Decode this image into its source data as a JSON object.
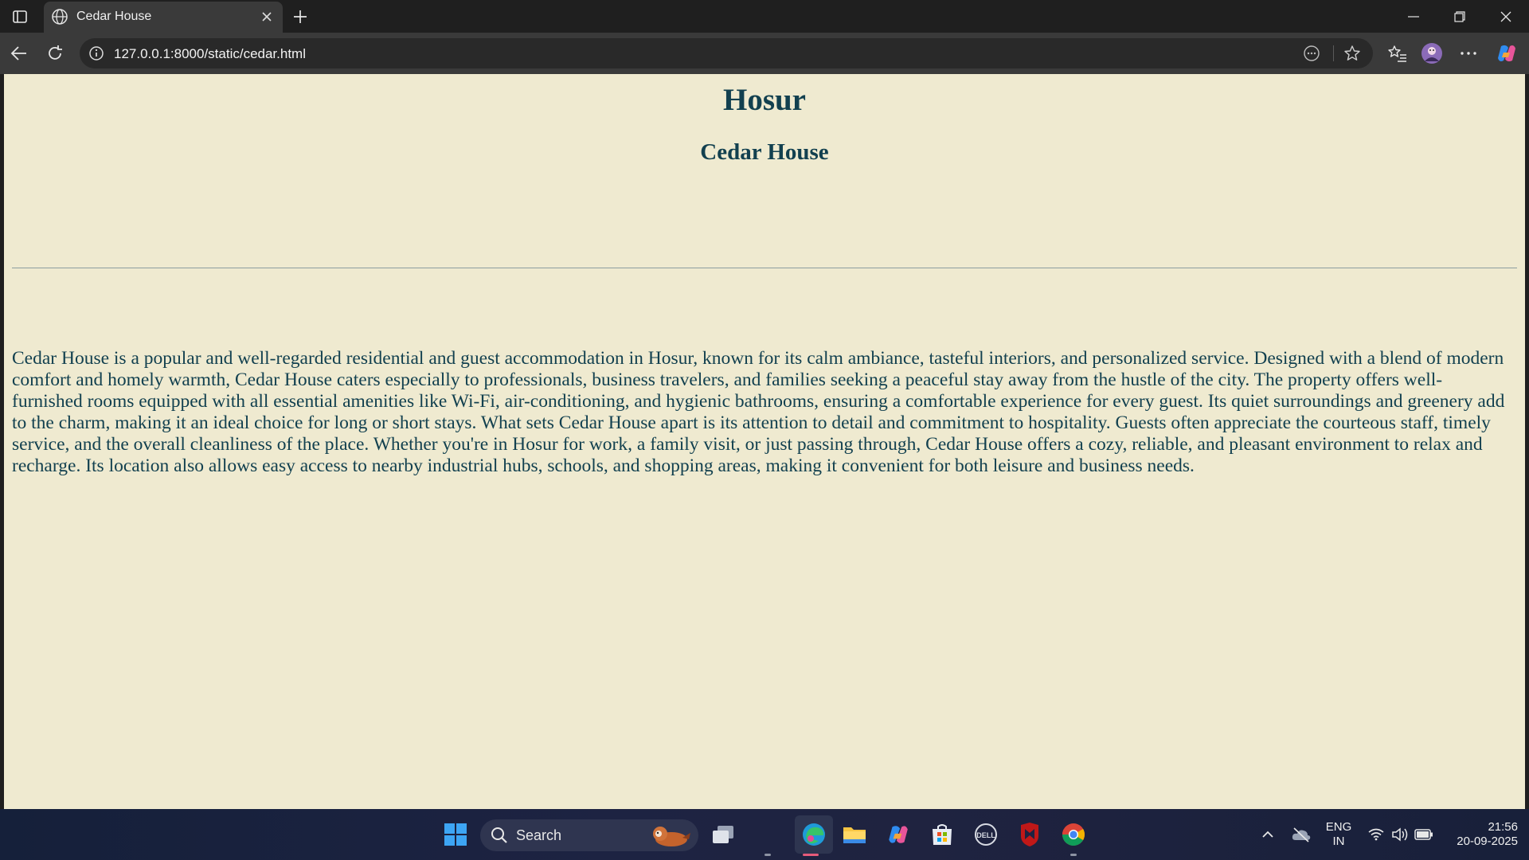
{
  "browser": {
    "tab": {
      "title": "Cedar House",
      "icon": "globe-icon"
    },
    "address_bar": {
      "url": "127.0.0.1:8000/static/cedar.html",
      "info_icon": "info-icon"
    },
    "toolbar_icons": [
      "reading-mode-icon",
      "favorite-star-icon",
      "favorites-list-icon",
      "profile-avatar",
      "more-menu-icon",
      "copilot-icon"
    ],
    "window_controls": [
      "minimize-icon",
      "restore-icon",
      "close-icon"
    ]
  },
  "page": {
    "heading": "Hosur",
    "subheading": "Cedar House",
    "description": "Cedar House is a popular and well-regarded residential and guest accommodation in Hosur, known for its calm ambiance, tasteful interiors, and personalized service. Designed with a blend of modern comfort and homely warmth, Cedar House caters especially to professionals, business travelers, and families seeking a peaceful stay away from the hustle of the city. The property offers well-furnished rooms equipped with all essential amenities like Wi-Fi, air-conditioning, and hygienic bathrooms, ensuring a comfortable experience for every guest. Its quiet surroundings and greenery add to the charm, making it an ideal choice for long or short stays. What sets Cedar House apart is its attention to detail and commitment to hospitality. Guests often appreciate the courteous staff, timely service, and the overall cleanliness of the place. Whether you're in Hosur for work, a family visit, or just passing through, Cedar House offers a cozy, reliable, and pleasant environment to relax and recharge. Its location also allows easy access to nearby industrial hubs, schools, and shopping areas, making it convenient for both leisure and business needs."
  },
  "taskbar": {
    "search_label": "Search",
    "apps": [
      "windows-start-icon",
      "task-view-icon",
      "edge-icon",
      "file-explorer-icon",
      "copilot-icon",
      "microsoft-store-icon",
      "dell-icon",
      "mcafee-icon",
      "chrome-icon"
    ],
    "tray": {
      "language_line1": "ENG",
      "language_line2": "IN",
      "time": "21:56",
      "date": "20-09-2025"
    }
  },
  "colors": {
    "page_background": "#efead0",
    "heading_color": "#12404f",
    "browser_chrome": "#3a3a3a",
    "title_bar": "#1f1f1f"
  }
}
